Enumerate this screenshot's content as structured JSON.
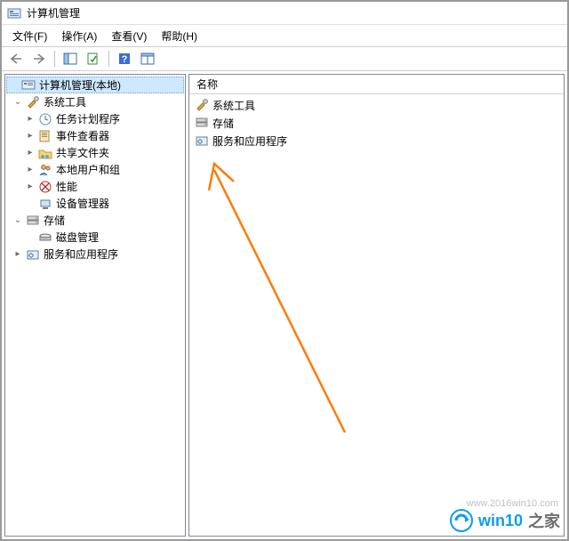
{
  "titlebar": {
    "title": "计算机管理"
  },
  "menubar": {
    "file": "文件(F)",
    "action": "操作(A)",
    "view": "查看(V)",
    "help": "帮助(H)"
  },
  "tree": {
    "root": "计算机管理(本地)",
    "system_tools": "系统工具",
    "task_scheduler": "任务计划程序",
    "event_viewer": "事件查看器",
    "shared_folders": "共享文件夹",
    "local_users": "本地用户和组",
    "performance": "性能",
    "device_manager": "设备管理器",
    "storage": "存储",
    "disk_management": "磁盘管理",
    "services_apps": "服务和应用程序"
  },
  "list": {
    "header_name": "名称",
    "rows": {
      "system_tools": "系统工具",
      "storage": "存储",
      "services_apps": "服务和应用程序"
    }
  },
  "watermark": {
    "brand1": "win10",
    "brand2": "之家",
    "url": "www.2016win10.com"
  }
}
